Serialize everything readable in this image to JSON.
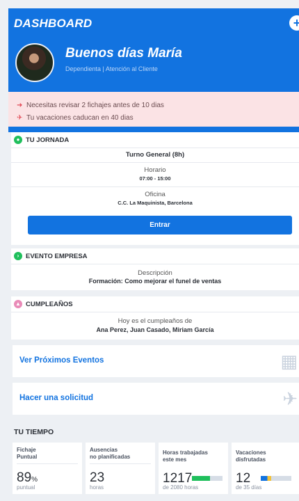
{
  "header": {
    "title": "DASHBOARD",
    "add_label": "+",
    "greeting": "Buenos días María",
    "role": "Dependienta | Atención al Cliente"
  },
  "alerts": [
    {
      "icon": "clock-out-icon",
      "text": "Necesitas revisar 2 fichajes antes de 10 dias"
    },
    {
      "icon": "plane-icon",
      "text": "Tu vacaciones caducan en 40 dias"
    }
  ],
  "jornada": {
    "title": "TU JORNADA",
    "shift": "Turno General (8h)",
    "schedule_label": "Horario",
    "schedule_value": "07:00 - 15:00",
    "office_label": "Oficina",
    "office_value": "C.C. La Maquinista, Barcelona",
    "button": "Entrar"
  },
  "evento": {
    "title": "EVENTO EMPRESA",
    "label": "Descripción",
    "value": "Formación: Como mejorar el funel de ventas"
  },
  "cumple": {
    "title": "CUMPLEAÑOS",
    "line1": "Hoy es el cumpleaños de",
    "line2": "Ana Perez, Juan Casado, Miriam García"
  },
  "links": {
    "eventos": "Ver Próximos Eventos",
    "solicitud": "Hacer una solicitud"
  },
  "tiempo": {
    "title": "TU TIEMPO",
    "tiles": [
      {
        "label1": "Fichaje",
        "label2": "Puntual",
        "value": "89",
        "unit": "%",
        "sub": "puntual"
      },
      {
        "label1": "Ausencias",
        "label2": "no planificadas",
        "value": "23",
        "unit": "",
        "sub": "horas"
      },
      {
        "label1": "Horas trabajadas",
        "label2": "este mes",
        "value": "1217",
        "unit": "",
        "sub": "de 2080 horas",
        "progress": 0.585
      },
      {
        "label1": "Vacaciones",
        "label2": "disfrutadas",
        "value": "12",
        "unit": "",
        "sub": "de 35 días",
        "progress": 0.34
      }
    ]
  },
  "colors": {
    "primary": "#1273e0",
    "alert_bg": "#fbe3e5",
    "alert_icon": "#e24a55",
    "success": "#1fbf5c",
    "birthday": "#e98bb8",
    "warning": "#f2c23a"
  }
}
